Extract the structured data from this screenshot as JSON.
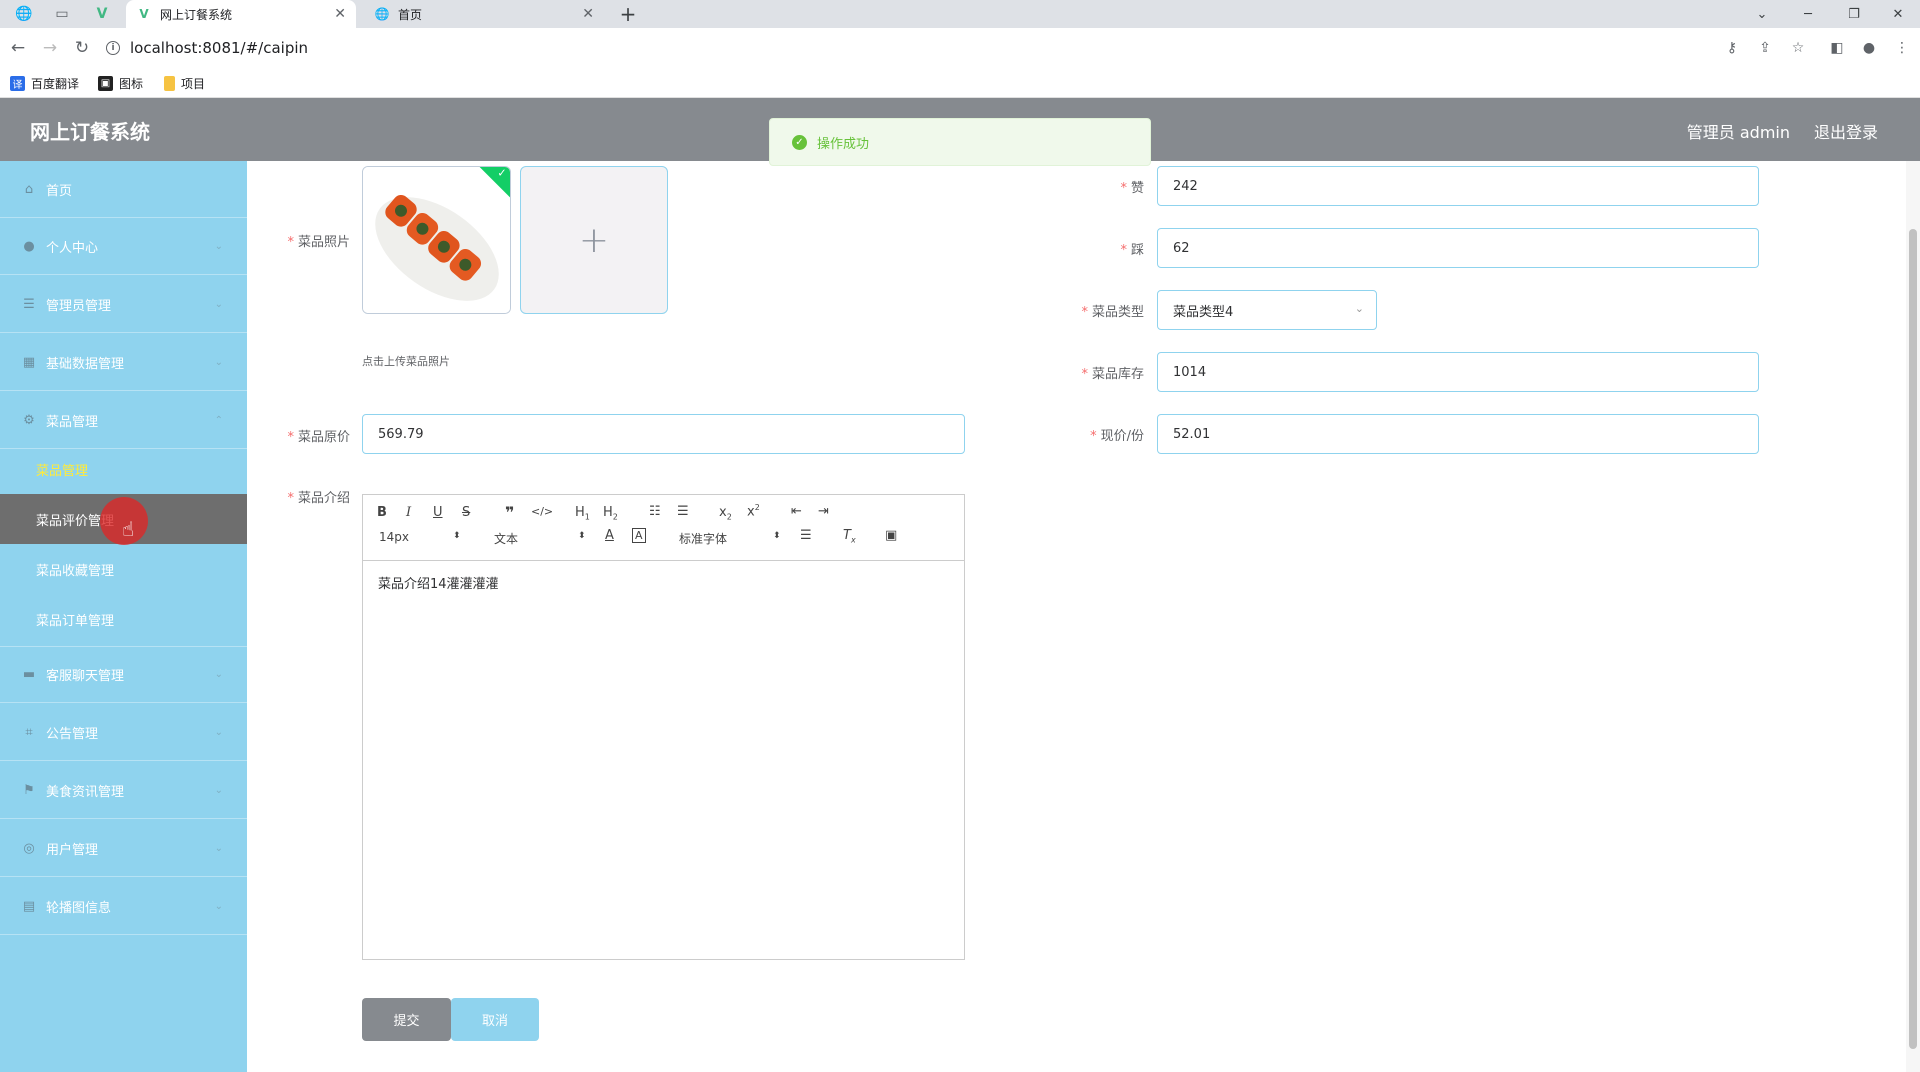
{
  "browser": {
    "tabs": [
      {
        "title": "网上订餐系统",
        "active": true
      },
      {
        "title": "首页",
        "active": false
      }
    ],
    "url": "localhost:8081/#/caipin",
    "bookmarks": [
      "百度翻译",
      "图标",
      "项目"
    ]
  },
  "header": {
    "title": "网上订餐系统",
    "user_label": "管理员 admin",
    "logout_label": "退出登录"
  },
  "toast": {
    "message": "操作成功"
  },
  "sidebar": {
    "items": [
      {
        "label": "首页",
        "icon": "home-icon"
      },
      {
        "label": "个人中心",
        "icon": "user-icon"
      },
      {
        "label": "管理员管理",
        "icon": "list-icon"
      },
      {
        "label": "基础数据管理",
        "icon": "grid-icon"
      },
      {
        "label": "菜品管理",
        "icon": "gear-icon"
      },
      {
        "label": "客服聊天管理",
        "icon": "monitor-icon"
      },
      {
        "label": "公告管理",
        "icon": "crop-icon"
      },
      {
        "label": "美食资讯管理",
        "icon": "flag-icon"
      },
      {
        "label": "用户管理",
        "icon": "compass-icon"
      },
      {
        "label": "轮播图信息",
        "icon": "clipboard-icon"
      }
    ],
    "sub_items": [
      {
        "label": "菜品管理"
      },
      {
        "label": "菜品评价管理"
      },
      {
        "label": "菜品收藏管理"
      },
      {
        "label": "菜品订单管理"
      }
    ]
  },
  "form": {
    "photo_label": "菜品照片",
    "upload_hint": "点击上传菜品照片",
    "original_price_label": "菜品原价",
    "original_price_value": "569.79",
    "intro_label": "菜品介绍",
    "intro_content": "菜品介绍14灌灌灌灌",
    "zan_label": "赞",
    "zan_value": "242",
    "cai_label": "踩",
    "cai_value": "62",
    "type_label": "菜品类型",
    "type_value": "菜品类型4",
    "stock_label": "菜品库存",
    "stock_value": "1014",
    "current_price_label": "现价/份",
    "current_price_value": "52.01",
    "submit_label": "提交",
    "cancel_label": "取消"
  },
  "editor_toolbar": {
    "font_size": "14px",
    "header": "文本",
    "font_family": "标准字体"
  }
}
